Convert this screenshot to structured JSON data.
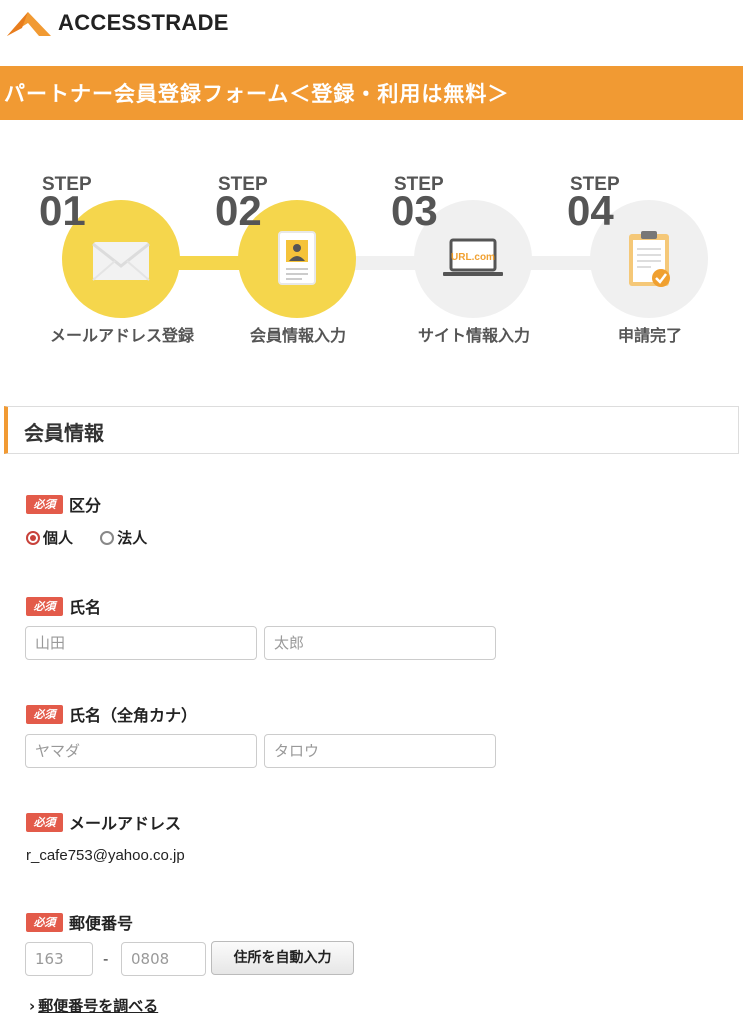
{
  "brand": {
    "name": "ACCESSTRADE",
    "color": "#f19a33"
  },
  "banner": {
    "title": "パートナー会員登録フォーム＜登録・利用は無料＞"
  },
  "steps": [
    {
      "word": "STEP",
      "num": "01",
      "label": "メールアドレス登録",
      "state": "done",
      "icon": "envelope-icon"
    },
    {
      "word": "STEP",
      "num": "02",
      "label": "会員情報入力",
      "state": "current",
      "icon": "member-card-icon"
    },
    {
      "word": "STEP",
      "num": "03",
      "label": "サイト情報入力",
      "state": "pending",
      "icon": "laptop-url-icon",
      "icon_text": "URL.com"
    },
    {
      "word": "STEP",
      "num": "04",
      "label": "申請完了",
      "state": "pending",
      "icon": "clipboard-check-icon"
    }
  ],
  "section": {
    "title": "会員情報"
  },
  "required_badge": "必須",
  "fields": {
    "category": {
      "label": "区分",
      "options": [
        {
          "label": "個人",
          "checked": true
        },
        {
          "label": "法人",
          "checked": false
        }
      ]
    },
    "name": {
      "label": "氏名",
      "last_placeholder": "山田",
      "first_placeholder": "太郎"
    },
    "kana": {
      "label": "氏名（全角カナ）",
      "last_placeholder": "ヤマダ",
      "first_placeholder": "タロウ"
    },
    "email": {
      "label": "メールアドレス",
      "value": "r_cafe753@yahoo.co.jp"
    },
    "postal": {
      "label": "郵便番号",
      "part1_placeholder": "163",
      "separator": "-",
      "part2_placeholder": "0808",
      "autofill_button": "住所を自動入力",
      "lookup_link": "郵便番号を調べる"
    }
  }
}
